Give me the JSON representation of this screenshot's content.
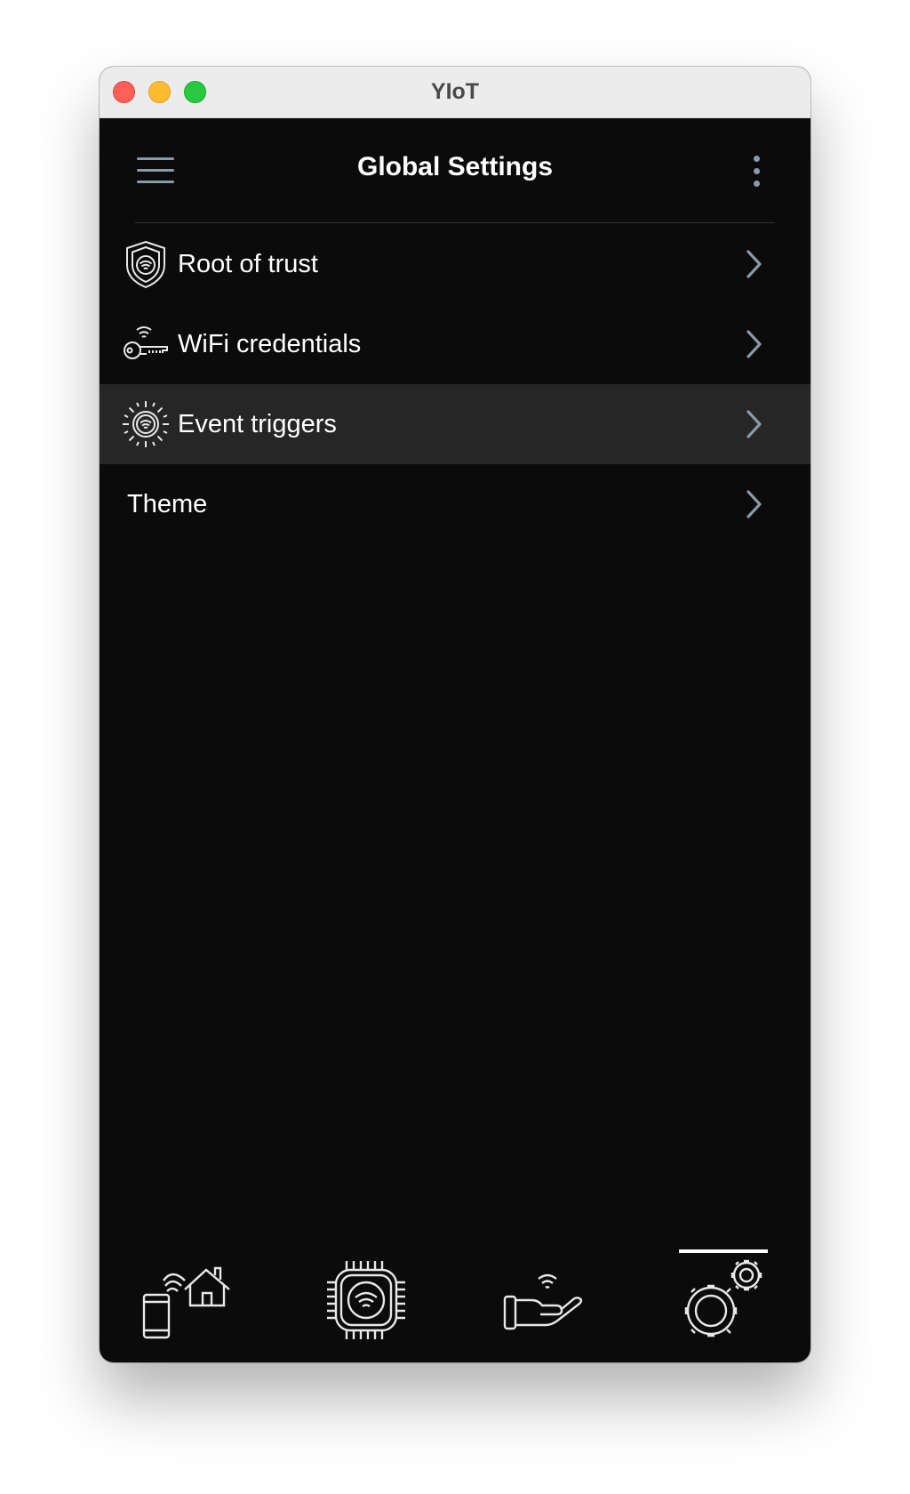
{
  "window": {
    "title": "YIoT"
  },
  "appbar": {
    "title": "Global Settings",
    "menu_icon": "hamburger-menu-icon",
    "more_icon": "more-vertical-icon"
  },
  "settings": {
    "items": [
      {
        "label": "Root of trust",
        "icon": "shield-wifi-icon"
      },
      {
        "label": "WiFi credentials",
        "icon": "wifi-key-icon"
      },
      {
        "label": "Event triggers",
        "icon": "event-trigger-icon",
        "highlighted": true
      },
      {
        "label": "Theme",
        "icon": ""
      }
    ]
  },
  "bottom_nav": {
    "items": [
      {
        "icon": "phone-home-icon"
      },
      {
        "icon": "chip-wifi-icon"
      },
      {
        "icon": "hand-wifi-icon"
      },
      {
        "icon": "gears-icon",
        "active": true
      }
    ]
  },
  "colors": {
    "background": "#0b0b0b",
    "highlight_row": "#262626",
    "text": "#ffffff",
    "chevron": "#8a9aa8",
    "active_indicator": "#ffffff"
  }
}
